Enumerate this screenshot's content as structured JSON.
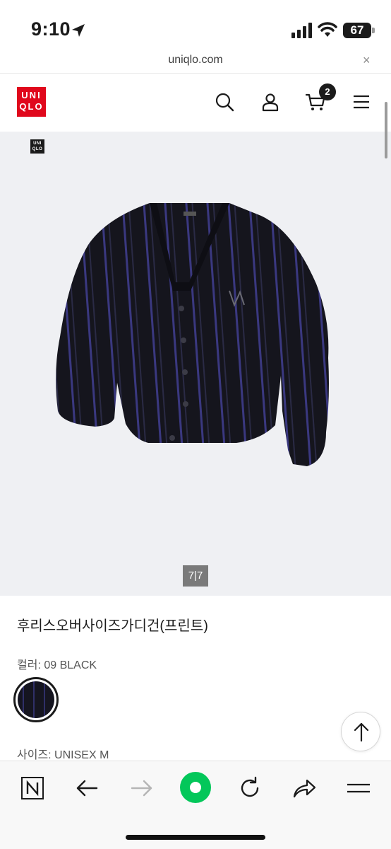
{
  "status_bar": {
    "time": "9:10",
    "battery": "67"
  },
  "url_bar": {
    "domain": "uniqlo.com",
    "close_symbol": "×"
  },
  "header": {
    "logo_line1": "UNI",
    "logo_line2": "QLO",
    "cart_count": "2",
    "icons": [
      "search-icon",
      "account-icon",
      "cart-icon",
      "menu-icon"
    ],
    "brand_color": "#e0081c"
  },
  "gallery": {
    "brand_mark_line1": "UNI",
    "brand_mark_line2": "QLO",
    "page_indicator": "7|7",
    "background": "#eff0f3"
  },
  "product": {
    "title": "후리스오버사이즈가디건(프린트)",
    "color_label": "컬러: 09 BLACK",
    "size_label": "사이즈: UNISEX M"
  },
  "toolbar": {
    "icons": [
      "naver-icon",
      "back-arrow-icon",
      "forward-arrow-icon",
      "green-dot-icon",
      "reload-icon",
      "share-icon",
      "menu-icon"
    ],
    "accent": "#03c75a"
  }
}
